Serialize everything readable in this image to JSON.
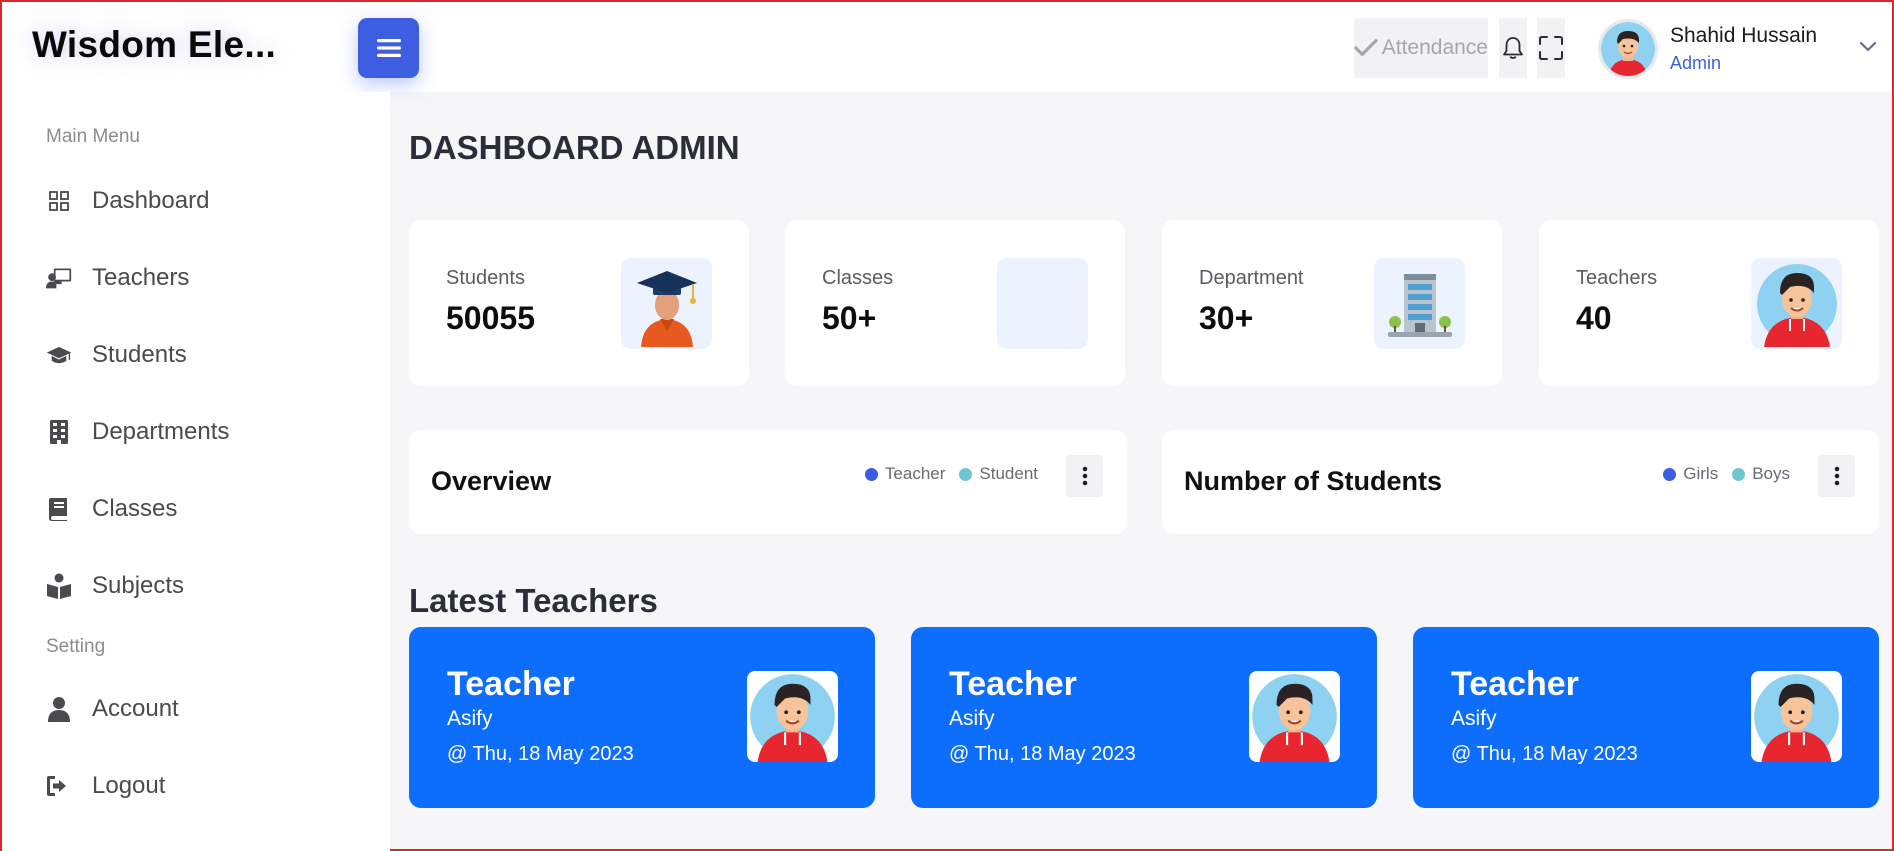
{
  "app": {
    "logo": "Wisdom Ele..."
  },
  "topbar": {
    "attendance_label": "Attendance",
    "user": {
      "name": "Shahid Hussain",
      "role": "Admin"
    }
  },
  "sidebar": {
    "main_menu_title": "Main Menu",
    "items": [
      {
        "label": "Dashboard",
        "icon": "grid-icon"
      },
      {
        "label": "Teachers",
        "icon": "chalkboard-teacher-icon"
      },
      {
        "label": "Students",
        "icon": "graduation-cap-icon"
      },
      {
        "label": "Departments",
        "icon": "building-icon"
      },
      {
        "label": "Classes",
        "icon": "book-icon"
      },
      {
        "label": "Subjects",
        "icon": "book-reader-icon"
      }
    ],
    "setting_title": "Setting",
    "setting_items": [
      {
        "label": "Account",
        "icon": "user-icon"
      },
      {
        "label": "Logout",
        "icon": "logout-icon"
      }
    ]
  },
  "main": {
    "page_title": "DASHBOARD ADMIN",
    "stats": [
      {
        "label": "Students",
        "value": "50055",
        "icon": "graduate-illustration"
      },
      {
        "label": "Classes",
        "value": "50+",
        "icon": "empty-image"
      },
      {
        "label": "Department",
        "value": "30+",
        "icon": "building-illustration"
      },
      {
        "label": "Teachers",
        "value": "40",
        "icon": "teacher-avatar"
      }
    ],
    "overview": {
      "title": "Overview",
      "legend": [
        {
          "label": "Teacher",
          "color": "#3d5ee1"
        },
        {
          "label": "Student",
          "color": "#70c4cf"
        }
      ]
    },
    "students_chart": {
      "title": "Number of Students",
      "legend": [
        {
          "label": "Girls",
          "color": "#3d5ee1"
        },
        {
          "label": "Boys",
          "color": "#70c4cf"
        }
      ]
    },
    "latest_teachers_title": "Latest Teachers",
    "latest_teachers": [
      {
        "title": "Teacher",
        "name": "Asify",
        "date": "@ Thu, 18 May 2023"
      },
      {
        "title": "Teacher",
        "name": "Asify",
        "date": "@ Thu, 18 May 2023"
      },
      {
        "title": "Teacher",
        "name": "Asify",
        "date": "@ Thu, 18 May 2023"
      }
    ]
  },
  "colors": {
    "primary": "#3d5ee1",
    "card_blue": "#0d6efd",
    "accent_teal": "#70c4cf",
    "background": "#f6f6f9"
  }
}
